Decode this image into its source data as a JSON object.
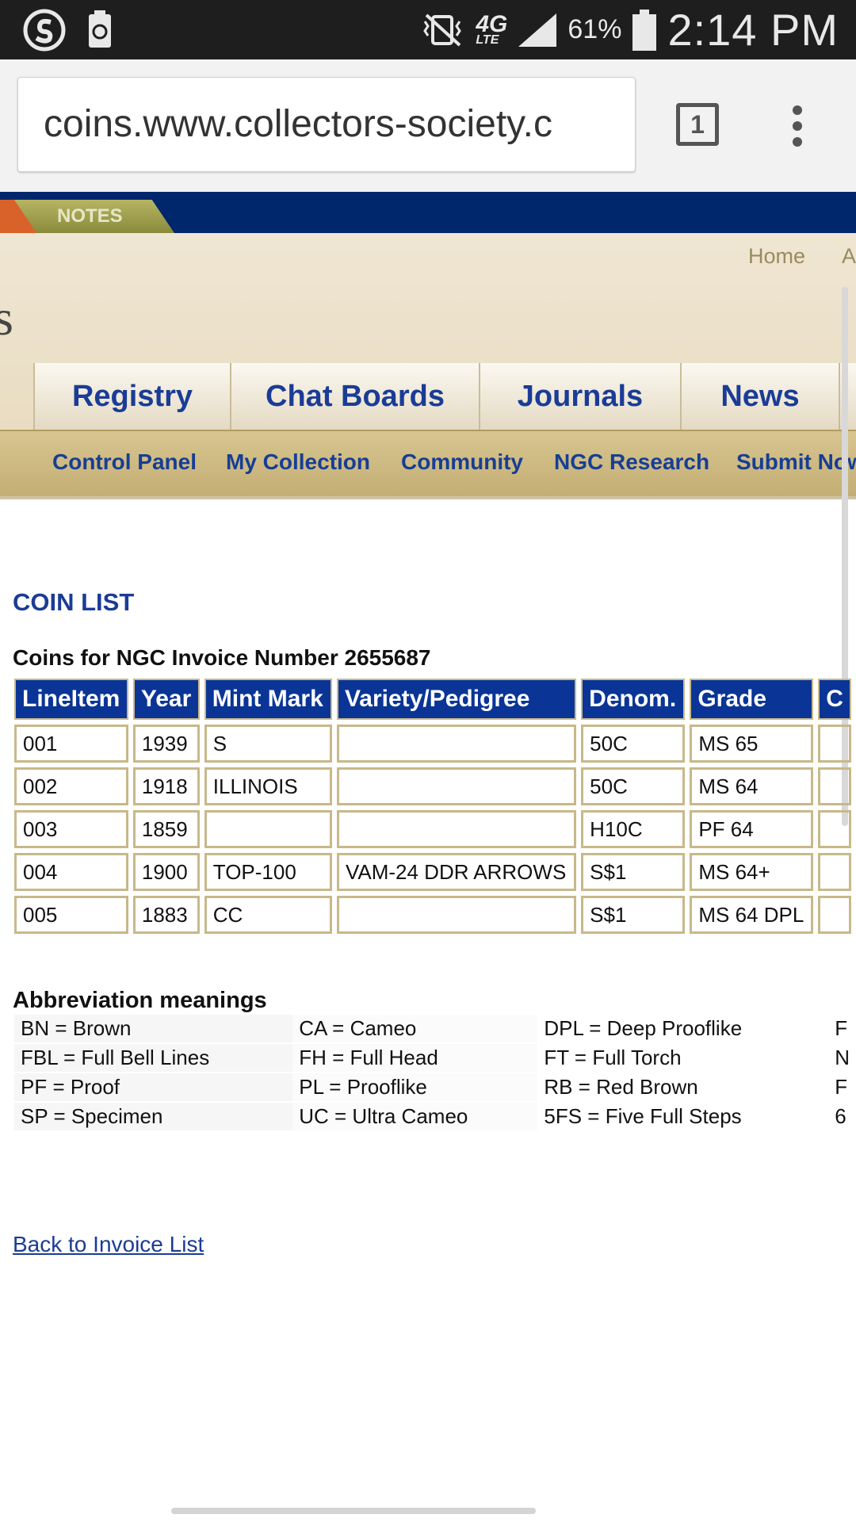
{
  "status": {
    "network": "4G",
    "network_sub": "LTE",
    "battery_pct": "61%",
    "time": "2:14 PM"
  },
  "browser": {
    "url": "coins.www.collectors-society.c",
    "tab_count": "1"
  },
  "header": {
    "notes_tab": "NOTES",
    "top_links": [
      "Home",
      "A"
    ],
    "logo_fragment": "s"
  },
  "main_nav": [
    "Registry",
    "Chat Boards",
    "Journals",
    "News"
  ],
  "sub_nav": [
    "Control Panel",
    "My Collection",
    "Community",
    "NGC Research",
    "Submit Now"
  ],
  "section_title": "COIN LIST",
  "invoice_title": "Coins for NGC Invoice Number 2655687",
  "coin_table": {
    "columns": [
      "LineItem",
      "Year",
      "Mint Mark",
      "Variety/Pedigree",
      "Denom.",
      "Grade",
      "C"
    ],
    "rows": [
      [
        "001",
        "1939",
        "S",
        "",
        "50C",
        "MS 65",
        ""
      ],
      [
        "002",
        "1918",
        "ILLINOIS",
        "",
        "50C",
        "MS 64",
        ""
      ],
      [
        "003",
        "1859",
        "",
        "",
        "H10C",
        "PF 64",
        ""
      ],
      [
        "004",
        "1900",
        "TOP-100",
        "VAM-24 DDR ARROWS",
        "S$1",
        "MS 64+",
        ""
      ],
      [
        "005",
        "1883",
        "CC",
        "",
        "S$1",
        "MS 64 DPL",
        ""
      ]
    ]
  },
  "abbreviations": {
    "title": "Abbreviation meanings",
    "rows": [
      [
        "BN  =  Brown",
        "CA  =  Cameo",
        "DPL  =  Deep Prooflike",
        "F"
      ],
      [
        "FBL  =  Full Bell Lines",
        "FH  =  Full Head",
        "FT  =  Full Torch",
        "N"
      ],
      [
        "PF  =  Proof",
        "PL  =  Prooflike",
        "RB  =  Red Brown",
        "F"
      ],
      [
        "SP  =  Specimen",
        "UC  =  Ultra Cameo",
        "5FS  =  Five Full Steps",
        "6"
      ]
    ]
  },
  "back_link": "Back to Invoice List",
  "colors": {
    "brand_blue": "#0a3596",
    "gold_border": "#c8b88a",
    "header_navy": "#00266b"
  }
}
